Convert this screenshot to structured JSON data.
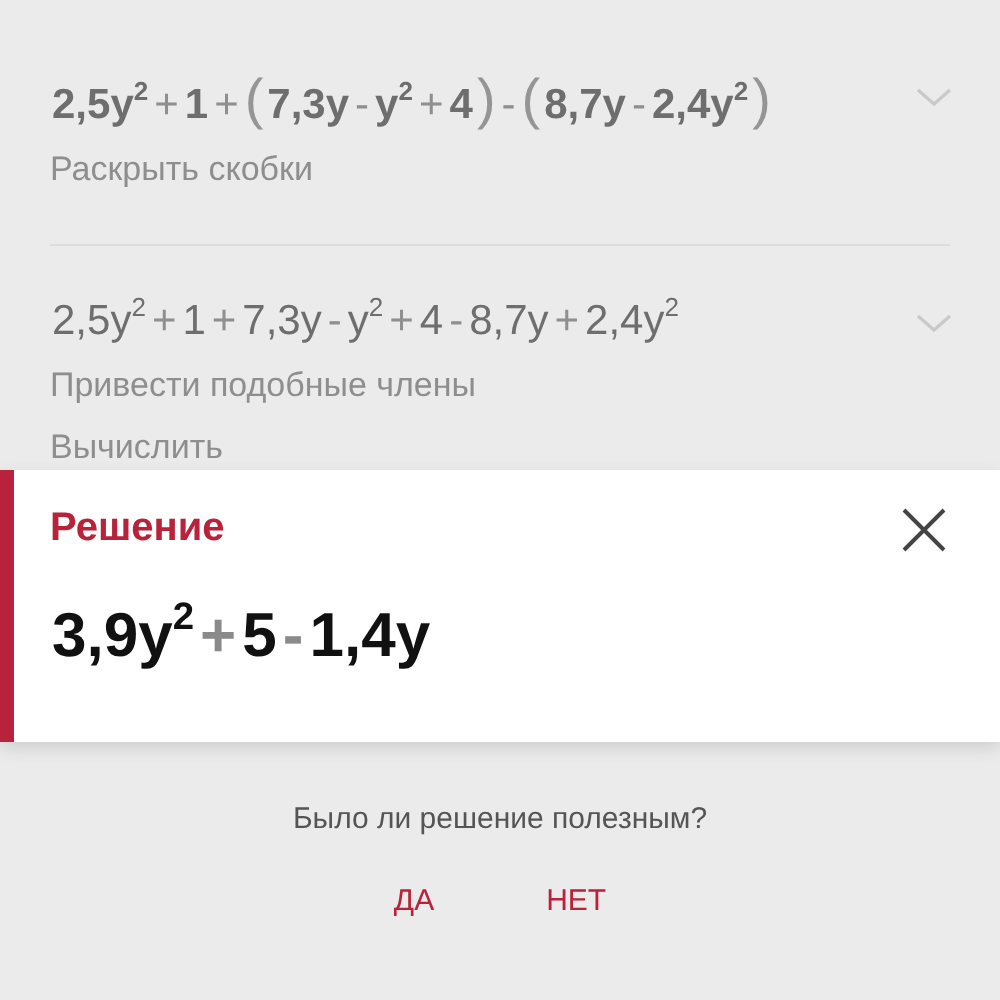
{
  "steps": [
    {
      "expression": [
        {
          "kind": "term",
          "text": "2,5y$^{2}$"
        },
        {
          "kind": "op",
          "text": "+"
        },
        {
          "kind": "term",
          "text": "1"
        },
        {
          "kind": "op",
          "text": "+"
        },
        {
          "kind": "paren",
          "text": "("
        },
        {
          "kind": "term",
          "text": "7,3y"
        },
        {
          "kind": "op",
          "text": "-"
        },
        {
          "kind": "term",
          "text": "y$^{2}$"
        },
        {
          "kind": "op",
          "text": "+"
        },
        {
          "kind": "term",
          "text": "4"
        },
        {
          "kind": "paren",
          "text": ")"
        },
        {
          "kind": "op",
          "text": "-"
        },
        {
          "kind": "paren",
          "text": "("
        },
        {
          "kind": "term",
          "text": "8,7y"
        },
        {
          "kind": "op",
          "text": "-"
        },
        {
          "kind": "term",
          "text": "2,4y$^{2}$"
        },
        {
          "kind": "paren",
          "text": ")"
        }
      ],
      "hints": [
        "Раскрыть скобки"
      ]
    },
    {
      "expression": [
        {
          "kind": "term",
          "text": "2,5y$^{2}$"
        },
        {
          "kind": "op",
          "text": "+"
        },
        {
          "kind": "term",
          "text": "1"
        },
        {
          "kind": "op",
          "text": "+"
        },
        {
          "kind": "term",
          "text": "7,3y"
        },
        {
          "kind": "op",
          "text": "-"
        },
        {
          "kind": "term",
          "text": "y$^{2}$"
        },
        {
          "kind": "op",
          "text": "+"
        },
        {
          "kind": "term",
          "text": "4"
        },
        {
          "kind": "op",
          "text": "-"
        },
        {
          "kind": "term",
          "text": "8,7y"
        },
        {
          "kind": "op",
          "text": "+"
        },
        {
          "kind": "term",
          "text": "2,4y$^{2}$"
        }
      ],
      "hints": [
        "Привести подобные члены",
        "Вычислить"
      ]
    }
  ],
  "solution": {
    "title": "Решение",
    "expression": [
      {
        "kind": "term",
        "text": "3,9y$^{2}$"
      },
      {
        "kind": "op",
        "text": "+"
      },
      {
        "kind": "term",
        "text": "5"
      },
      {
        "kind": "op",
        "text": "-"
      },
      {
        "kind": "term",
        "text": "1,4y"
      }
    ]
  },
  "feedback": {
    "question": "Было ли решение полезным?",
    "buttons": [
      "ДА",
      "НЕТ"
    ]
  }
}
